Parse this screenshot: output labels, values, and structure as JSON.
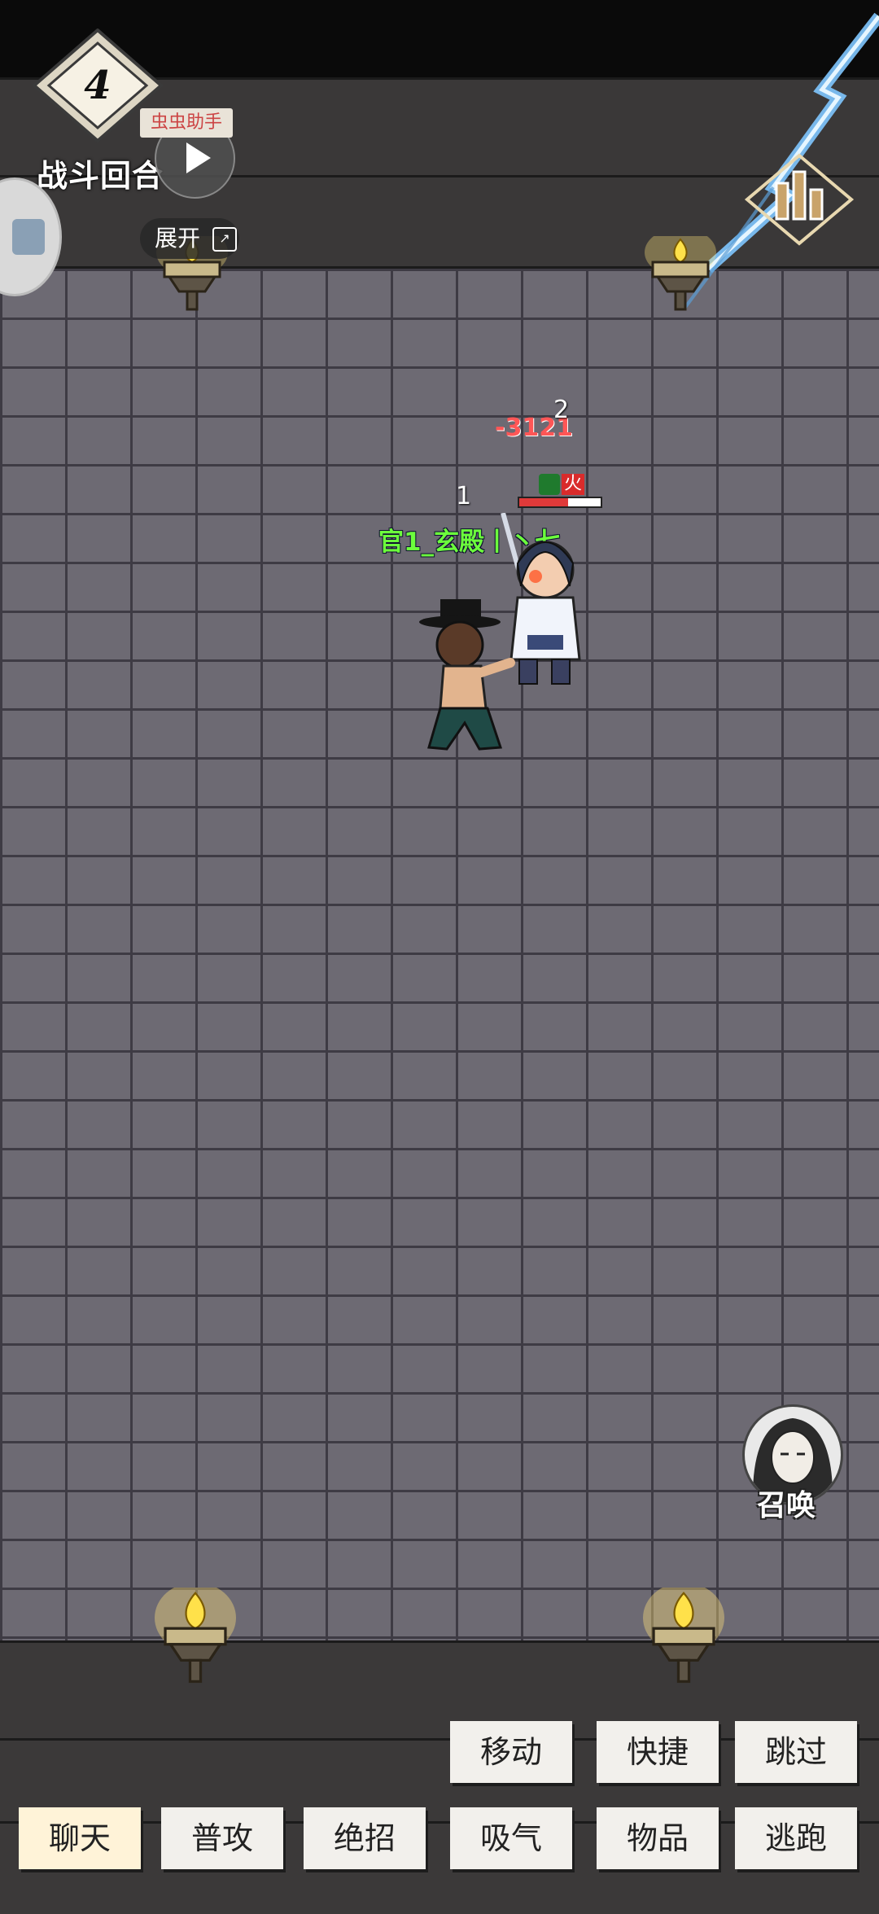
{
  "hud": {
    "round_number": "4",
    "round_label": "战斗回合",
    "helper_tag": "虫虫助手",
    "expand_label": "展开"
  },
  "battle": {
    "damage_text": "-3121",
    "unit_index_left": "1",
    "unit_index_right": "2",
    "player_name": "官1_玄殿丨丶七",
    "enemy_status": "火",
    "enemy_hp_fraction": 0.6
  },
  "summon": {
    "label": "召唤"
  },
  "actions": {
    "row1": [
      "移动",
      "快捷",
      "跳过"
    ],
    "row2": [
      "聊天",
      "普攻",
      "绝招",
      "吸气",
      "物品",
      "逃跑"
    ]
  }
}
